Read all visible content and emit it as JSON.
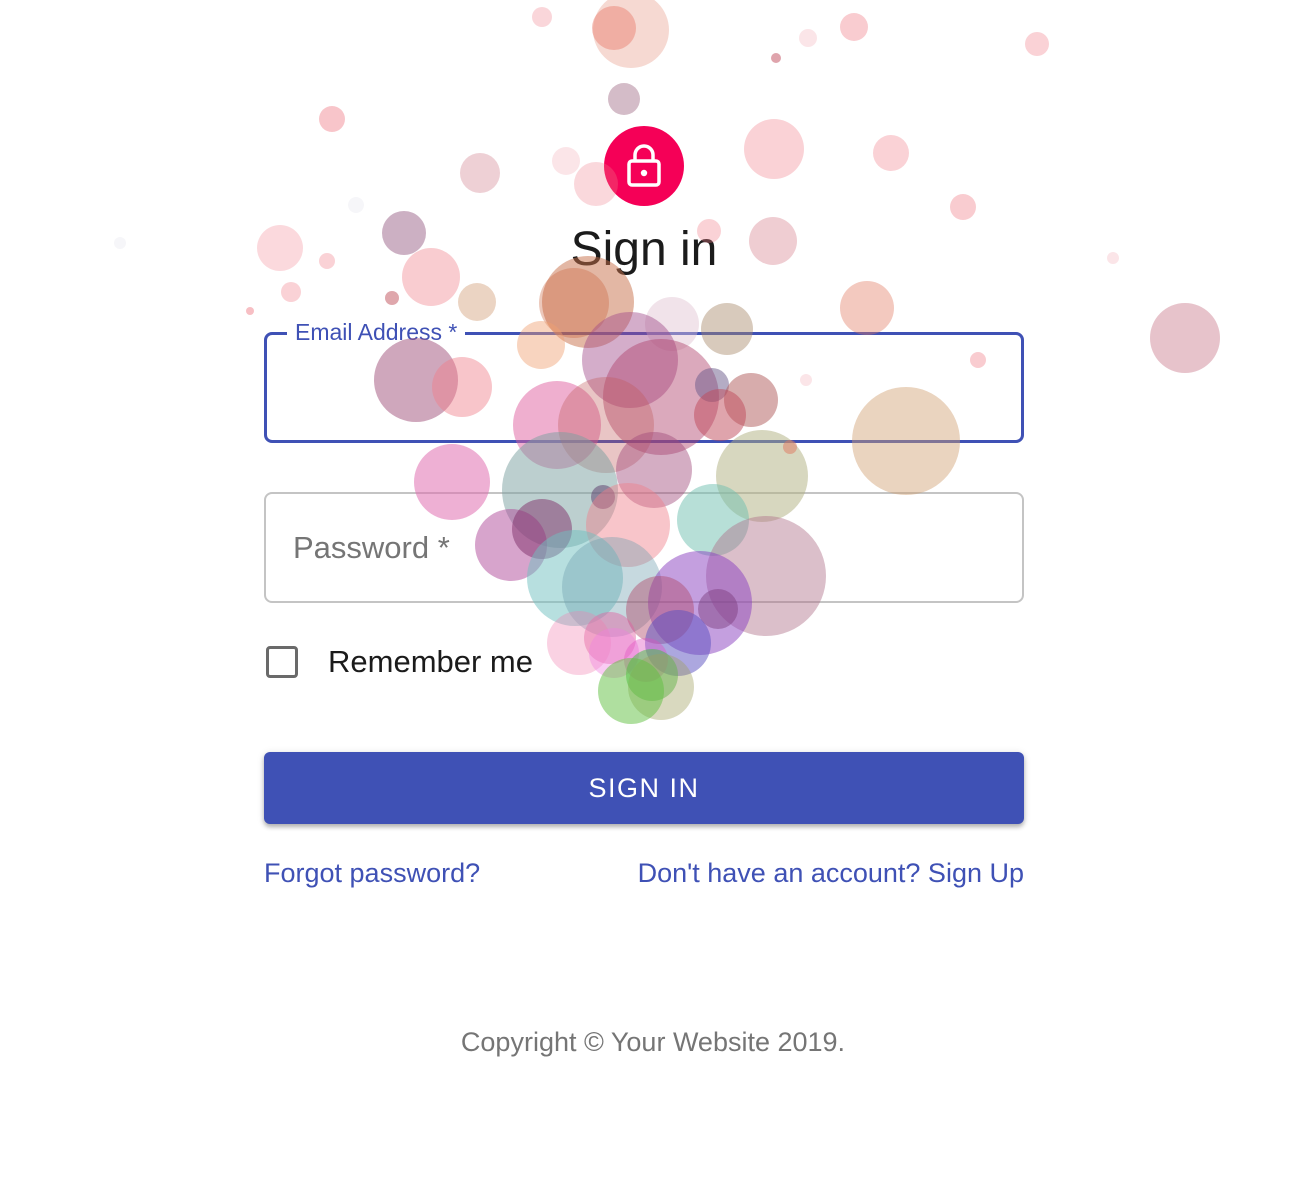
{
  "header": {
    "title": "Sign in",
    "avatar_icon": "lock-icon",
    "avatar_color": "#f50057"
  },
  "form": {
    "email": {
      "label": "Email Address *",
      "value": ""
    },
    "password": {
      "label": "Password *",
      "value": ""
    },
    "remember": {
      "label": "Remember me",
      "checked": false
    },
    "submit_label": "SIGN IN",
    "forgot_link": "Forgot password?",
    "signup_link": "Don't have an account? Sign Up"
  },
  "footer": {
    "copyright": "Copyright © Your Website 2019."
  },
  "colors": {
    "primary": "#3f51b5",
    "secondary": "#f50057",
    "text": "#1b1b1b",
    "muted": "#757575"
  }
}
